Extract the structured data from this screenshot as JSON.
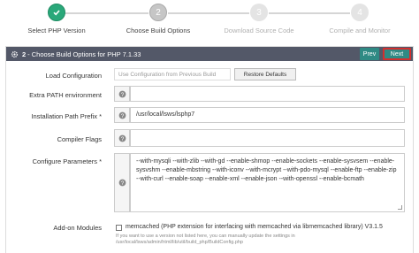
{
  "wizard": {
    "steps": [
      {
        "label": "Select PHP Version",
        "number": "",
        "state": "done"
      },
      {
        "label": "Choose Build Options",
        "number": "2",
        "state": "current"
      },
      {
        "label": "Download Source Code",
        "number": "3",
        "state": "future"
      },
      {
        "label": "Compile and Monitor",
        "number": "4",
        "state": "future"
      }
    ]
  },
  "panel": {
    "step_number": "2",
    "title": "- Choose Build Options for PHP 7.1.33",
    "prev_label": "Prev",
    "next_label": "Next"
  },
  "form": {
    "load_configuration": {
      "label": "Load Configuration",
      "placeholder": "Use Configuration from Previous Build",
      "restore_label": "Restore Defaults"
    },
    "extra_path": {
      "label": "Extra PATH environment",
      "value": ""
    },
    "install_prefix": {
      "label": "Installation Path Prefix *",
      "value": "/usr/local/lsws/lsphp7"
    },
    "compiler_flags": {
      "label": "Compiler Flags",
      "value": ""
    },
    "configure_params": {
      "label": "Configure Parameters *",
      "value": "--with-mysqli --with-zlib --with-gd --enable-shmop --enable-sockets --enable-sysvsem --enable-sysvshm --enable-mbstring --with-iconv --with-mcrypt --with-pdo-mysql --enable-ftp --enable-zip --with-curl --enable-soap --enable-xml --enable-json --with-openssl --enable-bcmath"
    },
    "addon_modules": {
      "label": "Add-on Modules",
      "option": "memcached (PHP extension for interfacing with memcached via libmemcached library) V3.1.5",
      "hint": "If you want to use a version not listed here, you can manually update the settings in /usr/local/lsws/admin/html/lib/util/build_php/BuildConfig.php"
    }
  },
  "colors": {
    "header_bg": "#535868",
    "done_step": "#2aa87a",
    "button": "#2f8a84",
    "next_highlight": "#d32f2f"
  }
}
